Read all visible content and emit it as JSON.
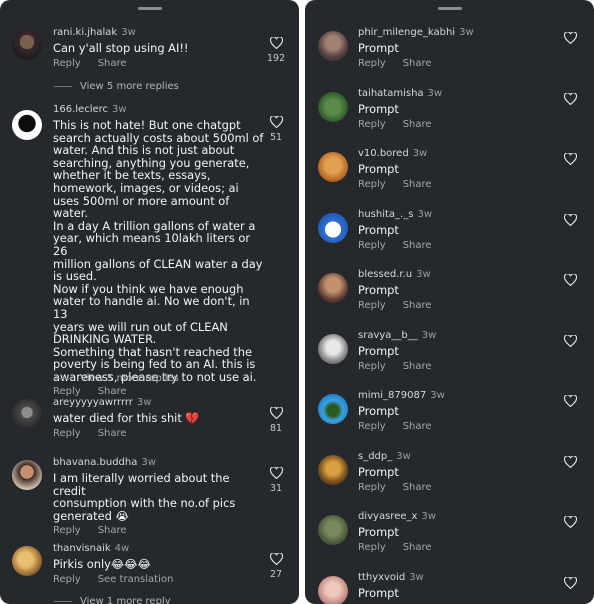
{
  "left": {
    "comments": [
      {
        "user": "rani.ki.jhalak",
        "time": "3w",
        "text": "Can y'all stop using AI!!",
        "actions": [
          "Reply",
          "Share"
        ],
        "likes": "192"
      },
      {
        "user": "166.leclerc",
        "time": "3w",
        "text": "This is not hate! But one chatgpt\nsearch actually costs about 500ml of\nwater. And this is not just about\nsearching, anything you generate,\nwhether it be texts, essays,\nhomework, images, or videos; ai\nuses 500ml or more amount of water.\n In a day A trillion gallons of water a\nyear, which means 10lakh liters or 26\nmillion gallons of CLEAN water a day\nis used.\n Now if you think we have enough\nwater to handle ai. No we don't, in 13\nyears we will run out of CLEAN\nDRINKING WATER.\n Something that hasn't reached the\npoverty is being fed to an AI. this is\nawareness, please try to not use ai.",
        "actions": [
          "Reply",
          "Share"
        ],
        "likes": "51"
      },
      {
        "user": "areyyyyyawrrrrr",
        "time": "3w",
        "text": "water died for this shit 💔",
        "actions": [
          "Reply",
          "Share"
        ],
        "likes": "81"
      },
      {
        "user": "bhavana.buddha",
        "time": "3w",
        "text": "I am literally worried about the credit\nconsumption with the no.of pics\ngenerated 😭",
        "actions": [
          "Reply",
          "Share"
        ],
        "likes": "31"
      },
      {
        "user": "thanvisnaik",
        "time": "4w",
        "text": "Pirkis only😂😂😂",
        "actions": [
          "Reply",
          "See translation"
        ],
        "likes": "27"
      }
    ],
    "view_more": [
      "View 5 more replies",
      "View 5 more replies",
      "View 1 more reply"
    ]
  },
  "right": {
    "comments": [
      {
        "user": "phir_milenge_kabhi",
        "time": "3w",
        "text": "Prompt",
        "actions": [
          "Reply",
          "Share"
        ]
      },
      {
        "user": "taihatamisha",
        "time": "3w",
        "text": "Prompt",
        "actions": [
          "Reply",
          "Share"
        ]
      },
      {
        "user": "v10.bored",
        "time": "3w",
        "text": "Prompt",
        "actions": [
          "Reply",
          "Share"
        ]
      },
      {
        "user": "hushita_._s",
        "time": "3w",
        "text": "Prompt",
        "actions": [
          "Reply",
          "Share"
        ]
      },
      {
        "user": "blessed.r.u",
        "time": "3w",
        "text": "Prompt",
        "actions": [
          "Reply",
          "Share"
        ]
      },
      {
        "user": "sravya__b__",
        "time": "3w",
        "text": "Prompt",
        "actions": [
          "Reply",
          "Share"
        ]
      },
      {
        "user": "mimi_879087",
        "time": "3w",
        "text": "Prompt",
        "actions": [
          "Reply",
          "Share"
        ]
      },
      {
        "user": "s_ddp_",
        "time": "3w",
        "text": "Prompt",
        "actions": [
          "Reply",
          "Share"
        ]
      },
      {
        "user": "divyasree_x",
        "time": "3w",
        "text": "Prompt",
        "actions": [
          "Reply",
          "Share"
        ]
      },
      {
        "user": "tthyxvoid",
        "time": "3w",
        "text": "Prompt",
        "actions": []
      }
    ]
  },
  "colors": {
    "panel": "#25292d",
    "text": "#f4f4f4",
    "secondary": "#a3a7ab"
  }
}
